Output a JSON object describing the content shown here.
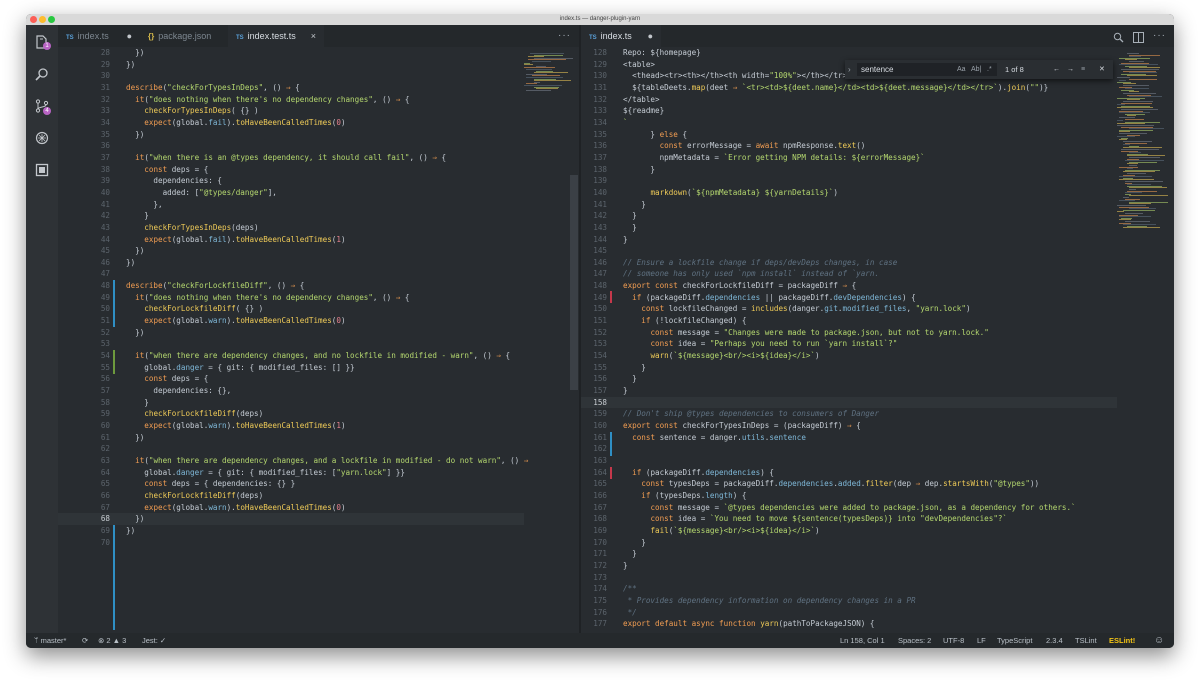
{
  "window": {
    "title": "index.ts — danger-plugin-yarn"
  },
  "colors": {
    "accent": "#efcb58",
    "badge": "#b864c4",
    "eslint": "#f2c316",
    "background": "#282c30"
  },
  "activity_bar": {
    "icons": [
      "explorer-icon",
      "search-icon",
      "source-control-icon",
      "debug-icon",
      "extensions-icon"
    ],
    "explorer_badge": "1",
    "scm_badge": "4"
  },
  "left_editor": {
    "tabs": [
      {
        "label": "index.ts",
        "icon": "TS",
        "state": "modified"
      },
      {
        "label": "package.json",
        "icon": "{}",
        "state": ""
      },
      {
        "label": "index.test.ts",
        "icon": "TS",
        "state": "active"
      }
    ],
    "close_glyph": "×",
    "modified_glyph": "●",
    "more_label": "···",
    "lines": [
      {
        "n": "28",
        "text": "  })"
      },
      {
        "n": "29",
        "text": "})"
      },
      {
        "n": "30",
        "text": ""
      },
      {
        "n": "31",
        "text": "describe(\"checkForTypesInDeps\", () ⇒ {"
      },
      {
        "n": "32",
        "text": "  it(\"does nothing when there's no dependency changes\", () ⇒ {"
      },
      {
        "n": "33",
        "text": "    checkForTypesInDeps( {} )"
      },
      {
        "n": "34",
        "text": "    expect(global.fail).toHaveBeenCalledTimes(0)"
      },
      {
        "n": "35",
        "text": "  })"
      },
      {
        "n": "36",
        "text": ""
      },
      {
        "n": "37",
        "text": "  it(\"when there is an @types dependency, it should call fail\", () ⇒ {"
      },
      {
        "n": "38",
        "text": "    const deps = {"
      },
      {
        "n": "39",
        "text": "      dependencies: {"
      },
      {
        "n": "40",
        "text": "        added: [\"@types/danger\"],"
      },
      {
        "n": "41",
        "text": "      },"
      },
      {
        "n": "42",
        "text": "    }"
      },
      {
        "n": "43",
        "text": "    checkForTypesInDeps(deps)"
      },
      {
        "n": "44",
        "text": "    expect(global.fail).toHaveBeenCalledTimes(1)"
      },
      {
        "n": "45",
        "text": "  })"
      },
      {
        "n": "46",
        "text": "})"
      },
      {
        "n": "47",
        "text": ""
      },
      {
        "n": "48",
        "text": "describe(\"checkForLockfileDiff\", () ⇒ {"
      },
      {
        "n": "49",
        "text": "  it(\"does nothing when there's no dependency changes\", () ⇒ {"
      },
      {
        "n": "50",
        "text": "    checkForLockfileDiff( {} )"
      },
      {
        "n": "51",
        "text": "    expect(global.warn).toHaveBeenCalledTimes(0)"
      },
      {
        "n": "52",
        "text": "  })"
      },
      {
        "n": "53",
        "text": ""
      },
      {
        "n": "54",
        "text": "  it(\"when there are dependency changes, and no lockfile in modified - warn\", () ⇒ {"
      },
      {
        "n": "55",
        "text": "    global.danger = { git: { modified_files: [] }}"
      },
      {
        "n": "56",
        "text": "    const deps = {"
      },
      {
        "n": "57",
        "text": "      dependencies: {},"
      },
      {
        "n": "58",
        "text": "    }"
      },
      {
        "n": "59",
        "text": "    checkForLockfileDiff(deps)"
      },
      {
        "n": "60",
        "text": "    expect(global.warn).toHaveBeenCalledTimes(1)"
      },
      {
        "n": "61",
        "text": "  })"
      },
      {
        "n": "62",
        "text": ""
      },
      {
        "n": "63",
        "text": "  it(\"when there are dependency changes, and a lockfile in modified - do not warn\", () ⇒"
      },
      {
        "n": "64",
        "text": "    global.danger = { git: { modified_files: [\"yarn.lock\"] }}"
      },
      {
        "n": "65",
        "text": "    const deps = { dependencies: {} }"
      },
      {
        "n": "66",
        "text": "    checkForLockfileDiff(deps)"
      },
      {
        "n": "67",
        "text": "    expect(global.warn).toHaveBeenCalledTimes(0)"
      },
      {
        "n": "68",
        "text": "  })"
      },
      {
        "n": "69",
        "text": "})"
      },
      {
        "n": "70",
        "text": ""
      }
    ]
  },
  "right_editor": {
    "tabs": [
      {
        "label": "index.ts",
        "icon": "TS",
        "state": "modified"
      }
    ],
    "modified_glyph": "●",
    "more_label": "···",
    "find_widget": {
      "query": "sentence",
      "match_count": "1 of 8",
      "case_label": "Aa",
      "word_label": "Ab|",
      "regex_label": ".*",
      "prev": "←",
      "next": "→",
      "selection": "≡",
      "close": "✕",
      "toggle": "›"
    },
    "lines": [
      {
        "n": "128",
        "text": "Repo: ${homepage}"
      },
      {
        "n": "129",
        "text": "<table>"
      },
      {
        "n": "130",
        "text": "  <thead><tr><th></th><th width=\"100%\"></th></tr></thead>"
      },
      {
        "n": "131",
        "text": "  ${tableDeets.map(deet ⇒ `<tr><td>${deet.name}</td><td>${deet.message}</td></tr>`).join(\"\")}"
      },
      {
        "n": "132",
        "text": "</table>"
      },
      {
        "n": "133",
        "text": "${readme}"
      },
      {
        "n": "134",
        "text": "`"
      },
      {
        "n": "135",
        "text": "      } else {"
      },
      {
        "n": "136",
        "text": "        const errorMessage = await npmResponse.text()"
      },
      {
        "n": "137",
        "text": "        npmMetadata = `Error getting NPM details: ${errorMessage}`"
      },
      {
        "n": "138",
        "text": "      }"
      },
      {
        "n": "139",
        "text": ""
      },
      {
        "n": "140",
        "text": "      markdown(`${npmMetadata} ${yarnDetails}`)"
      },
      {
        "n": "141",
        "text": "    }"
      },
      {
        "n": "142",
        "text": "  }"
      },
      {
        "n": "143",
        "text": "  }"
      },
      {
        "n": "144",
        "text": "}"
      },
      {
        "n": "145",
        "text": ""
      },
      {
        "n": "146",
        "text": "// Ensure a lockfile change if deps/devDeps changes, in case"
      },
      {
        "n": "147",
        "text": "// someone has only used `npm install` instead of `yarn."
      },
      {
        "n": "148",
        "text": "export const checkForLockfileDiff = packageDiff ⇒ {"
      },
      {
        "n": "149",
        "text": "  if (packageDiff.dependencies || packageDiff.devDependencies) {"
      },
      {
        "n": "150",
        "text": "    const lockfileChanged = includes(danger.git.modified_files, \"yarn.lock\")"
      },
      {
        "n": "151",
        "text": "    if (!lockfileChanged) {"
      },
      {
        "n": "152",
        "text": "      const message = \"Changes were made to package.json, but not to yarn.lock.\""
      },
      {
        "n": "153",
        "text": "      const idea = \"Perhaps you need to run `yarn install`?\""
      },
      {
        "n": "154",
        "text": "      warn(`${message}<br/><i>${idea}</i>`)"
      },
      {
        "n": "155",
        "text": "    }"
      },
      {
        "n": "156",
        "text": "  }"
      },
      {
        "n": "157",
        "text": "}"
      },
      {
        "n": "158",
        "text": ""
      },
      {
        "n": "159",
        "text": "// Don't ship @types dependencies to consumers of Danger"
      },
      {
        "n": "160",
        "text": "export const checkForTypesInDeps = (packageDiff) ⇒ {"
      },
      {
        "n": "161",
        "text": "  const sentence = danger.utils.sentence"
      },
      {
        "n": "162",
        "text": ""
      },
      {
        "n": "163",
        "text": ""
      },
      {
        "n": "164",
        "text": "  if (packageDiff.dependencies) {"
      },
      {
        "n": "165",
        "text": "    const typesDeps = packageDiff.dependencies.added.filter(dep ⇒ dep.startsWith(\"@types\"))"
      },
      {
        "n": "166",
        "text": "    if (typesDeps.length) {"
      },
      {
        "n": "167",
        "text": "      const message = `@types dependencies were added to package.json, as a dependency for others.`"
      },
      {
        "n": "168",
        "text": "      const idea = `You need to move ${sentence(typesDeps)} into \"devDependencies\"?`"
      },
      {
        "n": "169",
        "text": "      fail(`${message}<br/><i>${idea}</i>`)"
      },
      {
        "n": "170",
        "text": "    }"
      },
      {
        "n": "171",
        "text": "  }"
      },
      {
        "n": "172",
        "text": "}"
      },
      {
        "n": "173",
        "text": ""
      },
      {
        "n": "174",
        "text": "/**"
      },
      {
        "n": "175",
        "text": " * Provides dependency information on dependency changes in a PR"
      },
      {
        "n": "176",
        "text": " */"
      },
      {
        "n": "177",
        "text": "export default async function yarn(pathToPackageJSON) {"
      }
    ]
  },
  "statusbar": {
    "branch": "master*",
    "errors": "2",
    "warnings": "3",
    "jest": "Jest: ✓",
    "position": "Ln 158, Col 1",
    "spaces": "Spaces: 2",
    "encoding": "UTF-8",
    "eol": "LF",
    "language": "TypeScript",
    "version": "2.3.4",
    "tslint": "TSLint",
    "eslint": "ESLint!",
    "smiley": "☺"
  }
}
